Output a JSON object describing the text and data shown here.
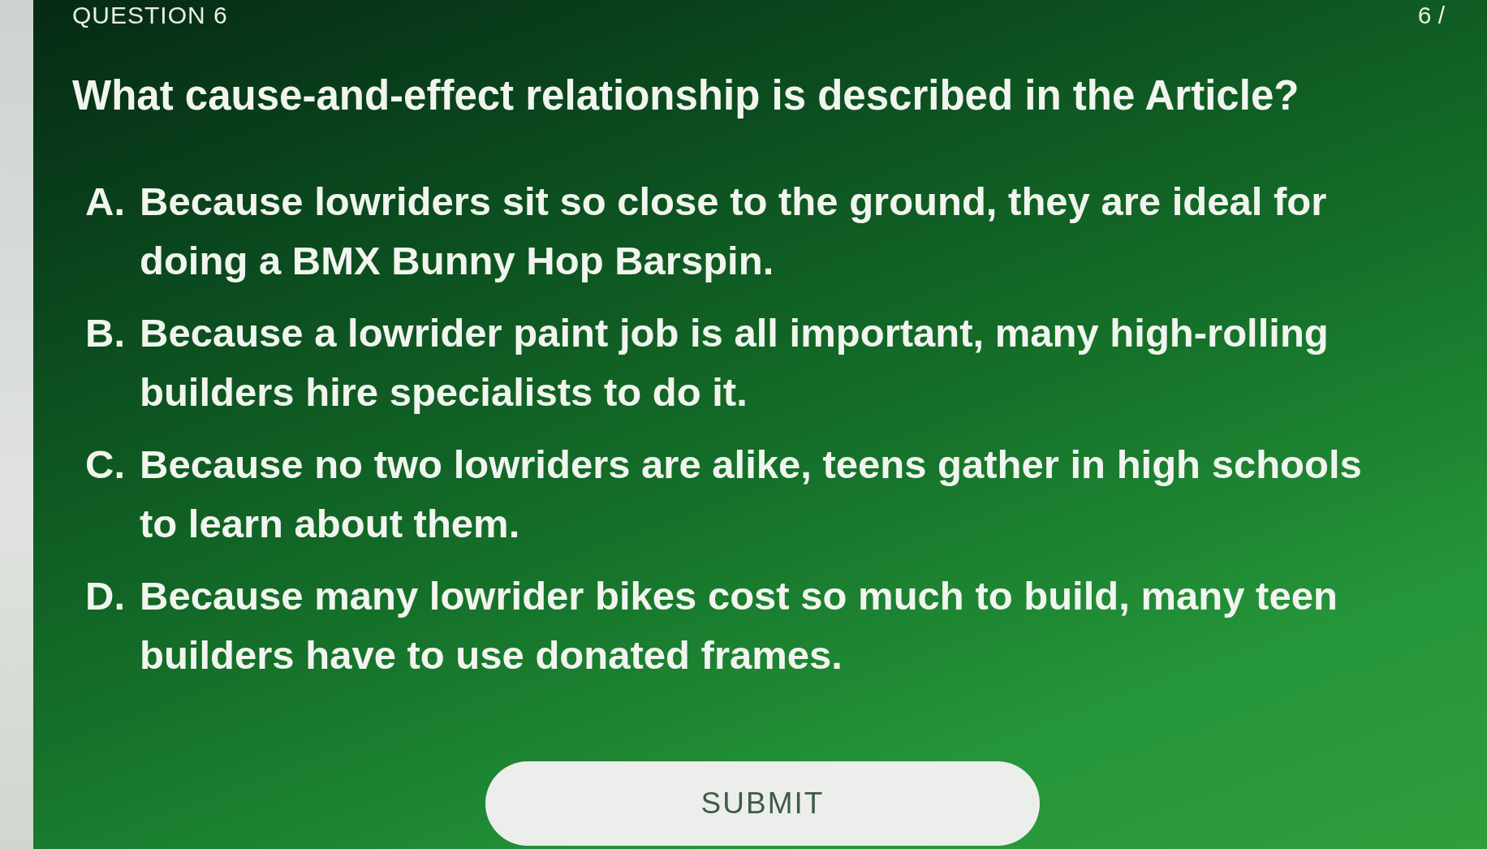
{
  "header": {
    "question_label": "QUESTION 6",
    "counter": "6 /"
  },
  "question": "What cause-and-effect relationship is described in the Article?",
  "options": [
    {
      "letter": "A.",
      "text": "Because lowriders sit so close to the ground, they are ideal for doing a BMX Bunny Hop Barspin."
    },
    {
      "letter": "B.",
      "text": "Because a lowrider paint job is all important, many high-rolling builders hire specialists to do it."
    },
    {
      "letter": "C.",
      "text": "Because no two lowriders are alike, teens gather in high schools to learn about them."
    },
    {
      "letter": "D.",
      "text": "Because many lowrider bikes cost so much to build, many teen builders have to use donated frames."
    }
  ],
  "submit_button": "SUBMIT"
}
